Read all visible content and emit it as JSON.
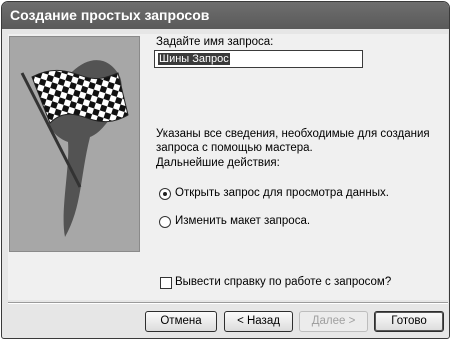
{
  "dialog": {
    "title": "Создание простых запросов"
  },
  "form": {
    "name_prompt": "Задайте имя запроса:",
    "name_value": "Шины Запрос",
    "info_line1": "Указаны все сведения, необходимые для создания",
    "info_line2": "запроса с помощью мастера.",
    "next_actions": "Дальнейшие действия:",
    "option_open": "Открыть запрос для просмотра данных.",
    "option_open_selected": true,
    "option_modify": "Изменить макет запроса.",
    "help_checkbox": "Вывести справку по работе с запросом?",
    "help_checked": false
  },
  "buttons": {
    "cancel": "Отмена",
    "back": "< Назад",
    "next": "Далее >",
    "finish": "Готово"
  }
}
